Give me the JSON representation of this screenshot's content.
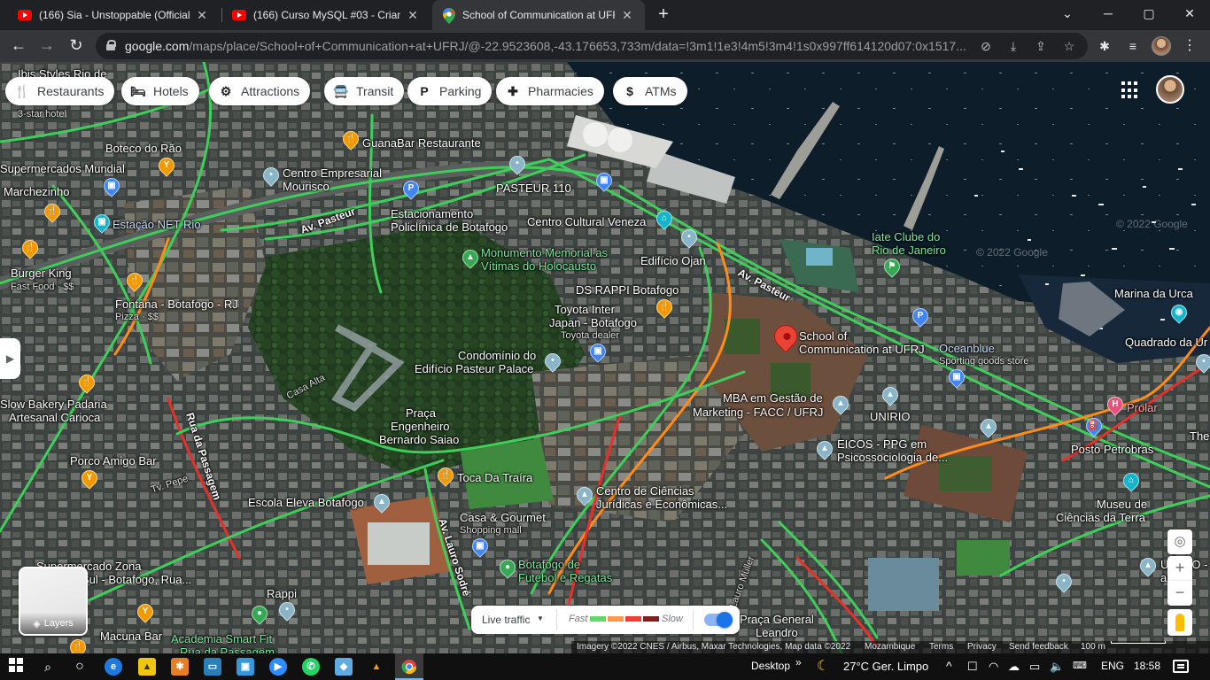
{
  "browser": {
    "tabs": [
      {
        "title": "(166) Sia - Unstoppable (Official V",
        "icon": "youtube-icon"
      },
      {
        "title": "(166) Curso MySQL #03 - Criando",
        "icon": "youtube-icon"
      },
      {
        "title": "School of Communication at UFRJ",
        "icon": "google-maps-icon",
        "active": true
      }
    ],
    "close_glyph": "✕",
    "new_tab_glyph": "+",
    "window_controls": {
      "minimize": "─",
      "maximize": "▢",
      "close": "✕",
      "tab_search": "⌄"
    },
    "url_host": "google.com",
    "url_path": "/maps/place/School+of+Communication+at+UFRJ/@-22.9523608,-43.176653,733m/data=!3m1!1e3!4m5!3m4!1s0x997ff614120d07:0x1517..."
  },
  "map": {
    "chips": [
      {
        "label": "Restaurants",
        "icon": "fork-knife-icon",
        "glyph": "🍴"
      },
      {
        "label": "Hotels",
        "icon": "bed-icon",
        "glyph": "🛏"
      },
      {
        "label": "Attractions",
        "icon": "camera-icon",
        "glyph": "⚙"
      },
      {
        "label": "Transit",
        "icon": "bus-icon",
        "glyph": "🚍"
      },
      {
        "label": "Parking",
        "icon": "parking-icon",
        "glyph": "P"
      },
      {
        "label": "Pharmacies",
        "icon": "pharmacy-icon",
        "glyph": "✚"
      },
      {
        "label": "ATMs",
        "icon": "atm-icon",
        "glyph": "$"
      }
    ],
    "places": {
      "ibis": "Ibis Styles Rio de",
      "ibis_sub": "3-star hotel",
      "boteco": "Boteco do Rão",
      "guanabar": "GuanaBar Restaurante",
      "supermercados": "Supermercados Mundial",
      "centro_empresarial": "Centro Empresarial",
      "mourisco": "Mourisco",
      "pasteur110": "PASTEUR 110",
      "marchezinho": "Marchezinho",
      "estacao_net": "Estação NET Rio",
      "av_pasteur_1": "Av. Pasteur",
      "estacionamento": "Estacionamento",
      "policlinica": "Policlínica de Botafogo",
      "centro_cultural": "Centro Cultural Veneza",
      "iate_clube": "Iate Clube do",
      "iate_clube_2": "Rio de Janeiro",
      "burger_king": "Burger King",
      "burger_king_sub": "Fast Food · $$",
      "monumento": "Monumento Memorial as",
      "monumento_2": "Vítimas do Holocausto",
      "edificio_ojan": "Edifício Ojan",
      "fontana": "Fontana - Botafogo - RJ",
      "fontana_sub": "Pizza · $$",
      "ds_rappi": "DS RAPPI Botafogo",
      "av_pasteur_2": "Av. Pasteur",
      "marina": "Marina da Urca",
      "toyota": "Toyota Inter",
      "toyota_2": "Japan - Botafogo",
      "toyota_sub": "Toyota dealer",
      "school": "School of",
      "school_2": "Communication at UFRJ",
      "oceanblue": "Oceanblue",
      "oceanblue_sub": "Sporting goods store",
      "quadrado": "Quadrado da Ur",
      "condominio": "Condomínio do",
      "condominio_2": "Edifício Pasteur Palace",
      "casa_alta": "Casa Alta",
      "slow_bakery": "Slow Bakery Padaria",
      "slow_bakery_2": "Artesanal Carioca",
      "mba": "MBA em Gestão de",
      "mba_2": "Marketing - FACC / UFRJ",
      "unirio": "UNIRIO",
      "prolar": "Prolar",
      "praca_eng": "Praça",
      "praca_eng_2": "Engenheiro",
      "praca_eng_3": "Bernardo Saiao",
      "rua_passagem": "Rua da Passagem",
      "porco_amigo": "Porco Amigo Bar",
      "eicos": "EICOS - PPG em",
      "eicos_2": "Psicossociologia de...",
      "posto": "Posto Petrobras",
      "the": "The",
      "toca": "Toca Da Traíra",
      "tv_pepe": "Tv. Pepe",
      "centro_ciencias": "Centro de Ciências",
      "centro_ciencias_2": "Jurídicas e Econômicas...",
      "museu": "Museu de",
      "museu_2": "Ciências da Terra",
      "escola_eleva": "Escola Eleva Botafogo",
      "casa_gourmet": "Casa & Gourmet",
      "casa_gourmet_sub": "Shopping mall",
      "supermercado_zona": "Supermercado Zona",
      "supermercado_zona_2": "Sul - Botafogo, Rua...",
      "botafogo_clube": "Botafogo de",
      "botafogo_clube_2": "Futebol e Regatas",
      "av_lauro": "Av. Lauro Sodré",
      "lauro_muller": "Lauro Müller",
      "urca_right": "UNIRIO -",
      "urca_right_2": "arts",
      "rappi": "Rappi",
      "macuna": "Macuna Bar",
      "academia": "Academia Smart Fit",
      "academia_2": "Rua da Passagem",
      "praca_general": "Praça General",
      "praca_general_2": "Leandro",
      "watermark_1": "© 2022 Google",
      "watermark_2": "© 2022 Google"
    },
    "layers_label": "Layers",
    "traffic": {
      "live": "Live traffic",
      "fast": "Fast",
      "slow": "Slow",
      "colors": [
        "#63d668",
        "#ff974d",
        "#f23c32",
        "#811f1f"
      ],
      "enabled": true
    },
    "zoom": {
      "in": "+",
      "out": "−"
    },
    "compass_glyph": "◎",
    "attribution": {
      "imagery": "Imagery ©2022 CNES / Airbus, Maxar Technologies, Map data ©2022",
      "region": "Mozambique",
      "terms": "Terms",
      "privacy": "Privacy",
      "feedback": "Send feedback",
      "scale": "100 m"
    }
  },
  "taskbar": {
    "desktop": "Desktop",
    "weather": "27°C  Ger. Limpo",
    "lang": "ENG",
    "time": "18:58",
    "chevron": "»",
    "up_caret": "^"
  }
}
